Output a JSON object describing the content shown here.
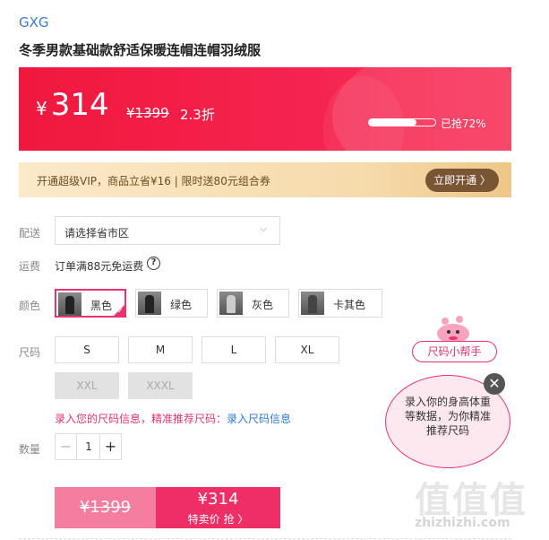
{
  "brand": "GXG",
  "title": "冬季男款基础款舒适保暖连帽连帽羽绒服",
  "price": {
    "currency": "¥",
    "current": "314",
    "original": "¥1399",
    "discount": "2.3折",
    "sold_percent": 72,
    "sold_label": "已抢72%"
  },
  "vip": {
    "text": "开通超级VIP，商品立省¥16 | 限时送80元组合券",
    "button": "立即开通 〉"
  },
  "delivery": {
    "label": "配送",
    "placeholder": "请选择省市区"
  },
  "shipping": {
    "label": "运费",
    "text": "订单满88元免运费",
    "help": "?"
  },
  "colors": {
    "label": "颜色",
    "options": [
      {
        "name": "黑色",
        "selected": true
      },
      {
        "name": "绿色",
        "selected": false
      },
      {
        "name": "灰色",
        "selected": false
      },
      {
        "name": "卡其色",
        "selected": false
      }
    ]
  },
  "sizes": {
    "label": "尺码",
    "options": [
      "S",
      "M",
      "L",
      "XL",
      "XXL",
      "XXXL"
    ],
    "disabled": [
      "XXL",
      "XXXL"
    ],
    "tip_text": "录入您的尺码信息，精准推荐尺码：",
    "tip_link": "录入尺码信息"
  },
  "quantity": {
    "label": "数量",
    "value": "1",
    "minus": "−",
    "plus": "+"
  },
  "buy": {
    "original": "¥1399",
    "price": "¥314",
    "action": "特卖价 抢 〉"
  },
  "size_helper": {
    "pill": "尺码小帮手",
    "bubble": "录入你的身高体重等数据，为你精准推荐尺码",
    "close": "✕"
  },
  "watermark": {
    "glyphs": "值值值",
    "url": "zhizhizhi.com"
  },
  "colors_theme": {
    "accent": "#ef2e66",
    "link": "#2a7bd5",
    "vip_button": "#7a5534"
  }
}
